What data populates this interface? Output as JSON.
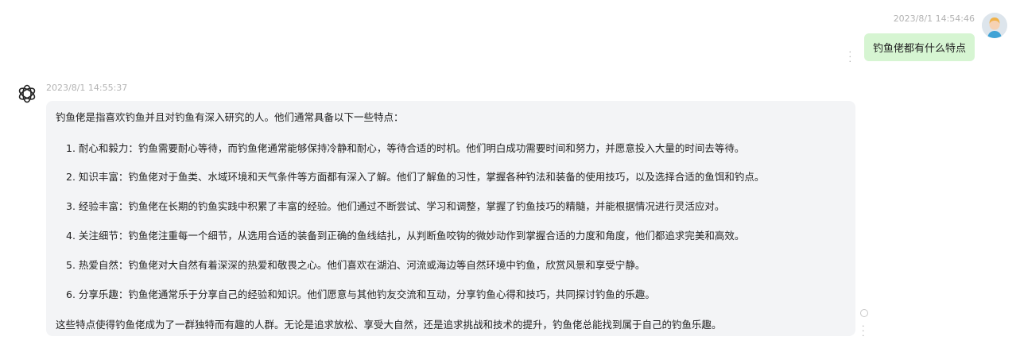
{
  "user_message": {
    "timestamp": "2023/8/1 14:54:46",
    "text": "钓鱼佬都有什么特点"
  },
  "bot_message": {
    "timestamp": "2023/8/1 14:55:37",
    "intro": "钓鱼佬是指喜欢钓鱼并且对钓鱼有深入研究的人。他们通常具备以下一些特点：",
    "items": [
      "1. 耐心和毅力：钓鱼需要耐心等待，而钓鱼佬通常能够保持冷静和耐心，等待合适的时机。他们明白成功需要时间和努力，并愿意投入大量的时间去等待。",
      "2. 知识丰富：钓鱼佬对于鱼类、水域环境和天气条件等方面都有深入了解。他们了解鱼的习性，掌握各种钓法和装备的使用技巧，以及选择合适的鱼饵和钓点。",
      "3. 经验丰富：钓鱼佬在长期的钓鱼实践中积累了丰富的经验。他们通过不断尝试、学习和调整，掌握了钓鱼技巧的精髓，并能根据情况进行灵活应对。",
      "4. 关注细节：钓鱼佬注重每一个细节，从选用合适的装备到正确的鱼线结扎，从判断鱼咬钩的微妙动作到掌握合适的力度和角度，他们都追求完美和高效。",
      "5. 热爱自然：钓鱼佬对大自然有着深深的热爱和敬畏之心。他们喜欢在湖泊、河流或海边等自然环境中钓鱼，欣赏风景和享受宁静。",
      "6. 分享乐趣：钓鱼佬通常乐于分享自己的经验和知识。他们愿意与其他钓友交流和互动，分享钓鱼心得和技巧，共同探讨钓鱼的乐趣。"
    ],
    "outro": "这些特点使得钓鱼佬成为了一群独特而有趣的人群。无论是追求放松、享受大自然，还是追求挑战和技术的提升，钓鱼佬总能找到属于自己的钓鱼乐趣。"
  },
  "icons": {
    "user_avatar": "user-avatar-icon",
    "bot_avatar": "openai-logo-icon",
    "more": "vertical-ellipsis-icon",
    "loading": "loading-circle-icon"
  }
}
